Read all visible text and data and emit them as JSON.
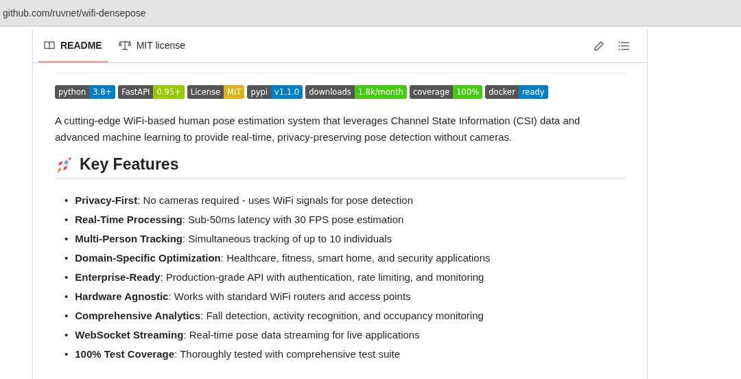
{
  "address_bar": {
    "url": "github.com/ruvnet/wifi-densepose"
  },
  "tabs": [
    {
      "label": "README",
      "selected": true
    },
    {
      "label": "MIT license",
      "selected": false
    }
  ],
  "badges": [
    {
      "label": "python",
      "value": "3.8+",
      "color": "#007ec6"
    },
    {
      "label": "FastAPI",
      "value": "0.95+",
      "color": "#97ca00"
    },
    {
      "label": "License",
      "value": "MIT",
      "color": "#dfb317"
    },
    {
      "label": "pypi",
      "value": "v1.1.0",
      "color": "#007ec6"
    },
    {
      "label": "downloads",
      "value": "1.8k/month",
      "color": "#4c1"
    },
    {
      "label": "coverage",
      "value": "100%",
      "color": "#4c1"
    },
    {
      "label": "docker",
      "value": "ready",
      "color": "#007ec6"
    }
  ],
  "description": "A cutting-edge WiFi-based human pose estimation system that leverages Channel State Information (CSI) data and advanced machine learning to provide real-time, privacy-preserving pose detection without cameras.",
  "heading": "Key Features",
  "features": [
    {
      "bullet": "•",
      "text": "**Privacy-First**: No cameras required - uses WiFi signals for pose detection"
    },
    {
      "bullet": "•",
      "text": "**Real-Time Processing**: Sub-50ms latency with 30 FPS pose estimation"
    },
    {
      "bullet": "•",
      "text": "**Multi-Person Tracking**: Simultaneous tracking of up to 10 individuals"
    },
    {
      "bullet": "•",
      "text": "**Domain-Specific Optimization**: Healthcare, fitness, smart home, and security applications"
    },
    {
      "bullet": "•",
      "text": "**Enterprise-Ready**: Production-grade API with authentication, rate limiting, and monitoring"
    },
    {
      "bullet": "•",
      "text": "**Hardware Agnostic**: Works with standard WiFi routers and access points"
    },
    {
      "bullet": "•",
      "text": "**Comprehensive Analytics**: Fall detection, activity recognition, and occupancy monitoring"
    },
    {
      "bullet": "•",
      "text": "**WebSocket Streaming**: Real-time pose data streaming for live applications"
    },
    {
      "bullet": "•",
      "text": "**100% Test Coverage**: Thoroughly tested with comprehensive test suite"
    }
  ]
}
